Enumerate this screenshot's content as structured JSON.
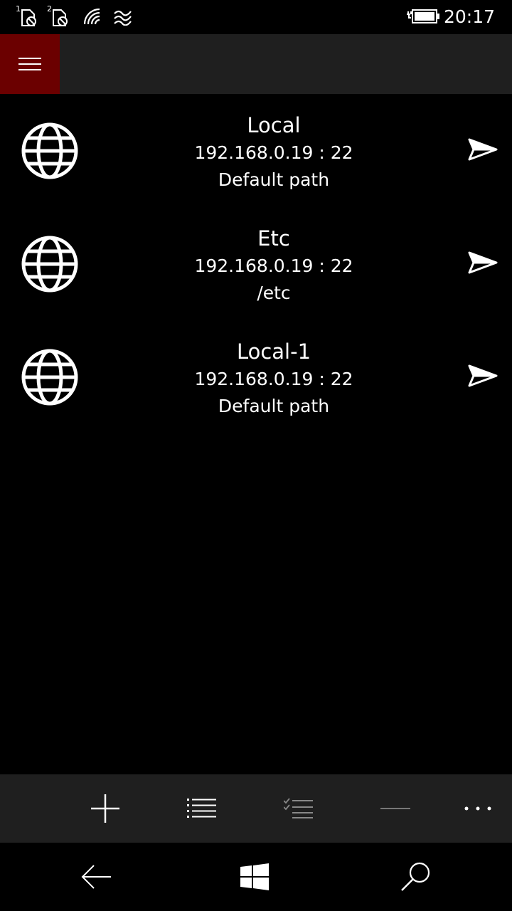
{
  "status_bar": {
    "time": "20:17",
    "sim1_label": "1",
    "sim2_label": "2",
    "icons": [
      "sim1-no-signal-icon",
      "sim2-no-signal-icon",
      "wifi-icon",
      "hotspot-icon",
      "battery-charging-icon"
    ]
  },
  "header": {
    "menu_icon": "hamburger-icon",
    "accent_color": "#6b0000"
  },
  "servers": [
    {
      "name": "Local",
      "address": "192.168.0.19 : 22",
      "path": "Default path"
    },
    {
      "name": "Etc",
      "address": "192.168.0.19 : 22",
      "path": "/etc"
    },
    {
      "name": "Local-1",
      "address": "192.168.0.19 : 22",
      "path": "Default path"
    }
  ],
  "app_bar": {
    "buttons": [
      "add-icon",
      "list-icon",
      "select-icon",
      "remove-icon",
      "more-icon"
    ]
  },
  "nav_bar": {
    "buttons": [
      "back-icon",
      "windows-icon",
      "search-icon"
    ]
  }
}
